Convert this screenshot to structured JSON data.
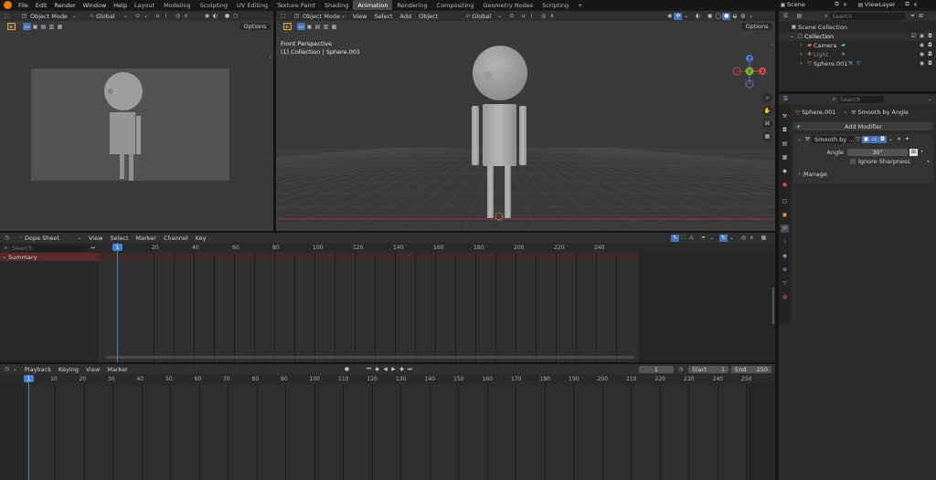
{
  "topbar": {
    "menus": [
      "File",
      "Edit",
      "Render",
      "Window",
      "Help"
    ],
    "workspaces": [
      "Layout",
      "Modeling",
      "Sculpting",
      "UV Editing",
      "Texture Paint",
      "Shading",
      "Animation",
      "Rendering",
      "Compositing",
      "Geometry Nodes",
      "Scripting"
    ],
    "active_workspace": "Animation",
    "add_tab": "+",
    "scene": "Scene",
    "view_layer": "ViewLayer"
  },
  "camera_view": {
    "mode": "Object Mode",
    "transform": "Global",
    "options": "Options"
  },
  "viewport": {
    "mode": "Object Mode",
    "menus": [
      "View",
      "Select",
      "Add",
      "Object"
    ],
    "transform": "Global",
    "overlay_line1": "Front Perspective",
    "overlay_line2": "(1) Collection | Sphere.001",
    "options": "Options",
    "gizmo": {
      "x": "X",
      "y": "Y",
      "z": "Z"
    }
  },
  "outliner": {
    "search_placeholder": "Search",
    "items": [
      {
        "label": "Scene Collection"
      },
      {
        "label": "Collection"
      },
      {
        "label": "Camera"
      },
      {
        "label": "Light"
      },
      {
        "label": "Sphere.001"
      }
    ]
  },
  "properties": {
    "search_placeholder": "Search",
    "breadcrumb_object": "Sphere.001",
    "breadcrumb_modifier": "Smooth by Angle",
    "add_modifier": "Add Modifier",
    "modifier_name": "Smooth by ...",
    "angle_label": "Angle",
    "angle_value": "30°",
    "ignore_sharpness": "Ignore Sharpness",
    "manage": "Manage"
  },
  "dopesheet": {
    "mode": "Dope Sheet",
    "menus": [
      "View",
      "Select",
      "Marker",
      "Channel",
      "Key"
    ],
    "search_placeholder": "Search",
    "summary": "Summary",
    "current_frame": "1",
    "ticks": [
      "20",
      "40",
      "60",
      "80",
      "100",
      "120",
      "140",
      "160",
      "180",
      "200",
      "220",
      "240"
    ]
  },
  "timeline": {
    "menus": [
      "Playback",
      "Keying",
      "View",
      "Marker"
    ],
    "frame": "1",
    "start_label": "Start",
    "start_value": "1",
    "end_label": "End",
    "end_value": "250",
    "current_frame": "1",
    "ticks": [
      "10",
      "20",
      "30",
      "40",
      "50",
      "60",
      "70",
      "80",
      "90",
      "100",
      "110",
      "120",
      "130",
      "140",
      "150",
      "160",
      "170",
      "180",
      "190",
      "200",
      "210",
      "220",
      "230",
      "240",
      "250"
    ]
  }
}
